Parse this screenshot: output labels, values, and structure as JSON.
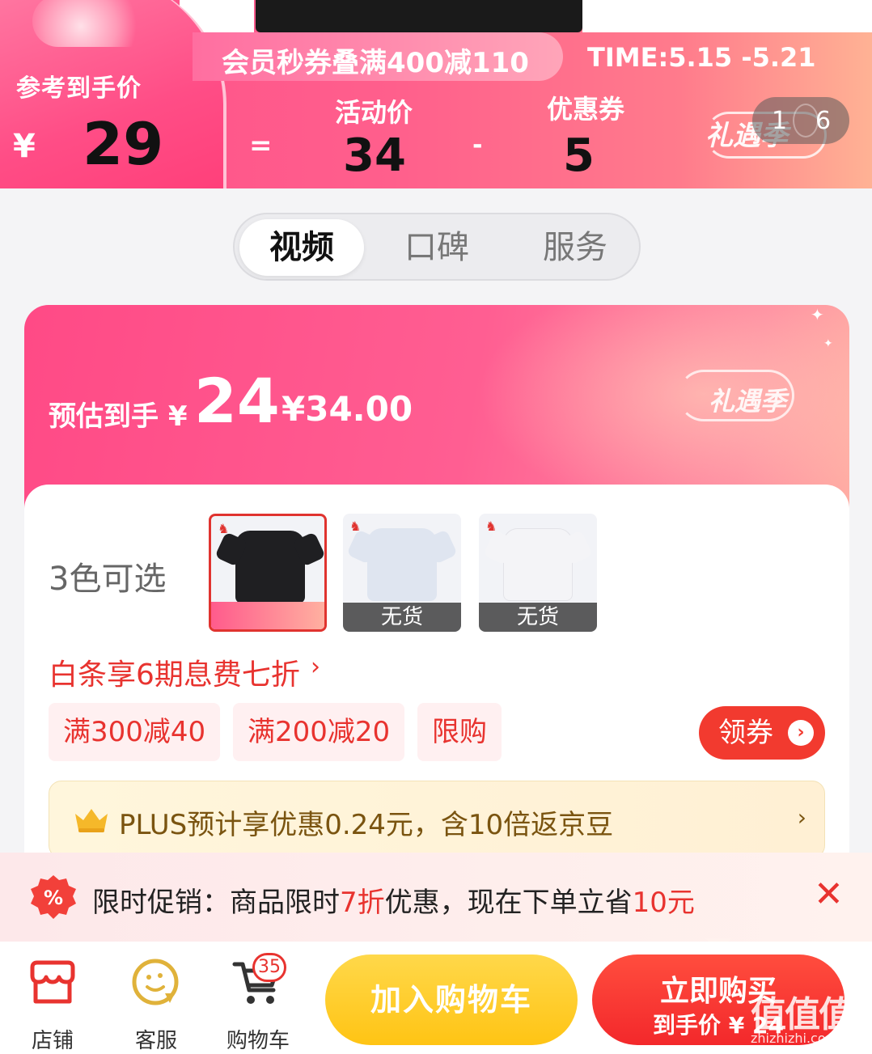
{
  "banner": {
    "ref_label": "参考到手价",
    "ref_yen": "¥",
    "ref_price": "29",
    "promo": "会员秒券叠满400减110",
    "time": "TIME:5.15 -5.21",
    "activity_label": "活动价",
    "coupon_label": "优惠券",
    "equals": "=",
    "minus": "-",
    "activity_price": "34",
    "coupon_value": "5",
    "logo": "礼遇季"
  },
  "pager": {
    "current": "1",
    "total": "6"
  },
  "tabs": [
    "视频",
    "口碑",
    "服务"
  ],
  "price_card": {
    "est_label": "预估到手 ¥",
    "est_price": "24",
    "orig_price": "¥34.00",
    "chevron": "›",
    "logo": "礼遇季"
  },
  "colors": {
    "label": "3色可选",
    "swatches": [
      {
        "color": "#1f1f22",
        "status": ""
      },
      {
        "color": "#dfe5f0",
        "status": "无货"
      },
      {
        "color": "#f4f4f7",
        "status": "无货"
      }
    ]
  },
  "baitiao": {
    "text": "白条享6期息费七折",
    "chevron": "›"
  },
  "chips": [
    "满300减40",
    "满200减20",
    "限购"
  ],
  "get_coupon": {
    "label": "领券",
    "icon": "›"
  },
  "plus": {
    "text": "PLUS预计享优惠0.24元，含10倍返京豆",
    "chevron": "›"
  },
  "flash": {
    "prefix": "限时促销：商品限时",
    "discount": "7折",
    "middle": "优惠，现在下单立省",
    "saving": "10元",
    "close": "✕"
  },
  "bottom": {
    "store": "店铺",
    "service": "客服",
    "cart": "购物车",
    "cart_count": "35",
    "add_cart": "加入购物车",
    "buy_now": "立即购买",
    "buy_sub": "到手价 ¥ 24"
  },
  "watermark": {
    "main": "值值值",
    "sub": "zhizhizhi.com"
  },
  "theme": {
    "accent": "#e8332f",
    "pink": "#ff4f8a",
    "yellow": "#ffc414"
  }
}
